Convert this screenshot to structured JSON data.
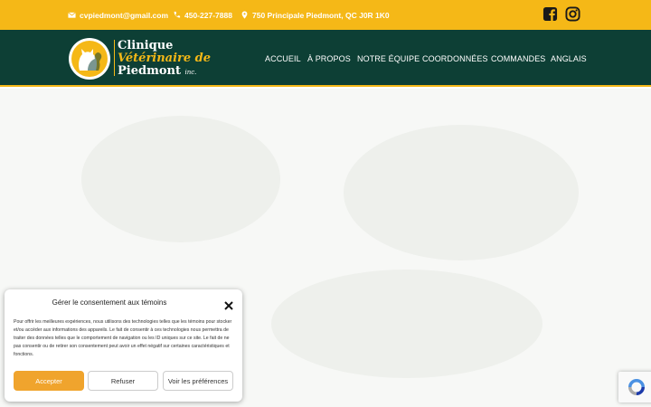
{
  "topbar": {
    "email": "cvpiedmont@gmail.com",
    "phone": "450-227-7888",
    "address": "750 Principale Piedmont, QC J0R 1K0",
    "social": [
      "facebook-icon",
      "instagram-icon"
    ]
  },
  "logo": {
    "line1": "Clinique",
    "line2": "Vétérinaire de",
    "line3": "Piedmont",
    "suffix": "inc."
  },
  "nav": {
    "items": [
      "ACCUEIL",
      "À PROPOS",
      "NOTRE ÉQUIPE",
      "COORDONNÉES",
      "COMMANDES",
      "ANGLAIS"
    ]
  },
  "consent": {
    "title": "Gérer le consentement aux témoins",
    "body": "Pour offrir les meilleures expériences, nous utilisons des technologies telles que les témoins pour stocker et/ou accéder aux informations des appareils. Le fait de consentir à ces technologies nous permettra de traiter des données telles que le comportement de navigation ou les ID uniques sur ce site. Le fait de ne pas consentir ou de retirer son consentement peut avoir un effet négatif sur certaines caractéristiques et fonctions.",
    "accept_label": "Accepter",
    "refuse_label": "Refuser",
    "prefs_label": "Voir les préférences"
  },
  "colors": {
    "brand_yellow": "#f5b817",
    "brand_green": "#0d3f35",
    "accept_orange": "#f0a42d"
  }
}
